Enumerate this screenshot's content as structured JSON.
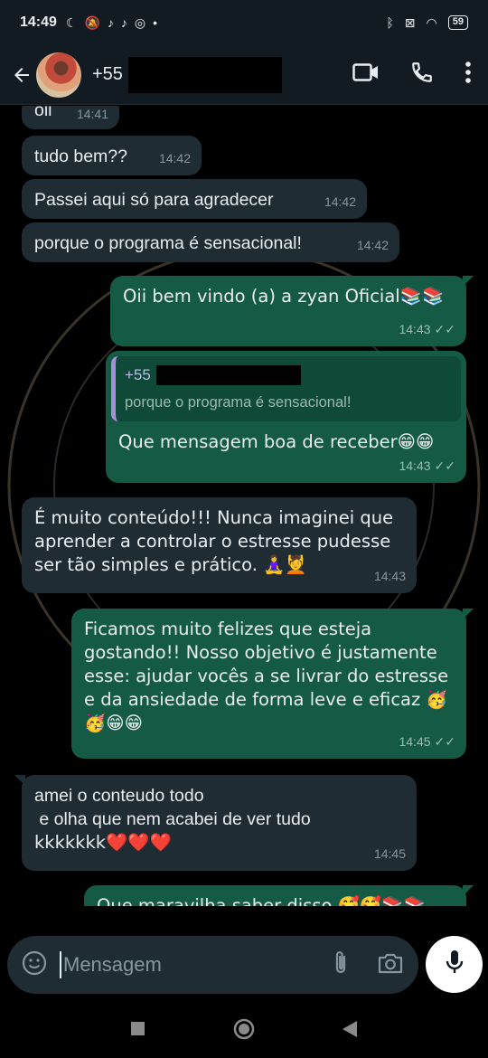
{
  "status_bar": {
    "time": "14:49",
    "battery": "59"
  },
  "header": {
    "contact": "+55"
  },
  "messages": [
    {
      "text": "oii",
      "time": "14:41"
    },
    {
      "text": "tudo bem??",
      "time": "14:42"
    },
    {
      "text": "Passei aqui só para agradecer",
      "time": "14:42"
    },
    {
      "text": "porque o programa é sensacional!",
      "time": "14:42"
    },
    {
      "text": "Oii bem vindo (a) a zyan Oficial📚📚",
      "time": "14:43"
    },
    {
      "quote_name": "+55",
      "quote_text": "porque o programa é sensacional!",
      "text": "Que mensagem boa de receber😁😁",
      "time": "14:43"
    },
    {
      "text": "É muito conteúdo!!! Nunca imaginei que aprender a controlar o estresse pudesse ser tão simples e prático. 🧘‍♀️💆",
      "time": "14:43"
    },
    {
      "text": "Ficamos muito felizes que esteja gostando!! Nosso objetivo é justamente esse: ajudar vocês a se livrar do estresse e da ansiedade de forma leve e eficaz 🥳🥳😁😁",
      "time": "14:45"
    },
    {
      "line1": "amei o conteudo todo",
      "line2": " e olha que nem acabei de ver tudo",
      "line3": "kkkkkkk❤️❤️❤️",
      "time": "14:45"
    },
    {
      "text": "Que maravilha saber disso 🥰🥰📚📚"
    }
  ],
  "input": {
    "placeholder": "Mensagem"
  },
  "colors": {
    "incoming": "#1f2c33",
    "outgoing": "#145a44",
    "quote_bar": "#a98ee0"
  }
}
